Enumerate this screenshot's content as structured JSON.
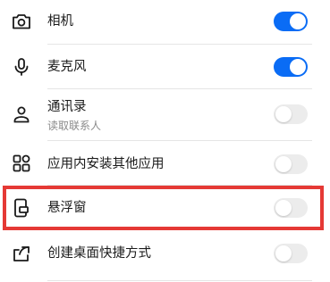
{
  "permissions": [
    {
      "icon": "camera-icon",
      "label": "相机",
      "sublabel": null,
      "enabled": true
    },
    {
      "icon": "microphone-icon",
      "label": "麦克风",
      "sublabel": null,
      "enabled": true
    },
    {
      "icon": "contacts-person-icon",
      "label": "通讯录",
      "sublabel": "读取联系人",
      "enabled": false
    },
    {
      "icon": "app-grid-icon",
      "label": "应用内安装其他应用",
      "sublabel": null,
      "enabled": false
    },
    {
      "icon": "floating-window-icon",
      "label": "悬浮窗",
      "sublabel": null,
      "enabled": false
    },
    {
      "icon": "share-export-icon",
      "label": "创建桌面快捷方式",
      "sublabel": null,
      "enabled": false
    }
  ],
  "colors": {
    "toggle_on": "#0a6cf5",
    "toggle_off": "#ececec",
    "highlight_border": "#e53935"
  }
}
